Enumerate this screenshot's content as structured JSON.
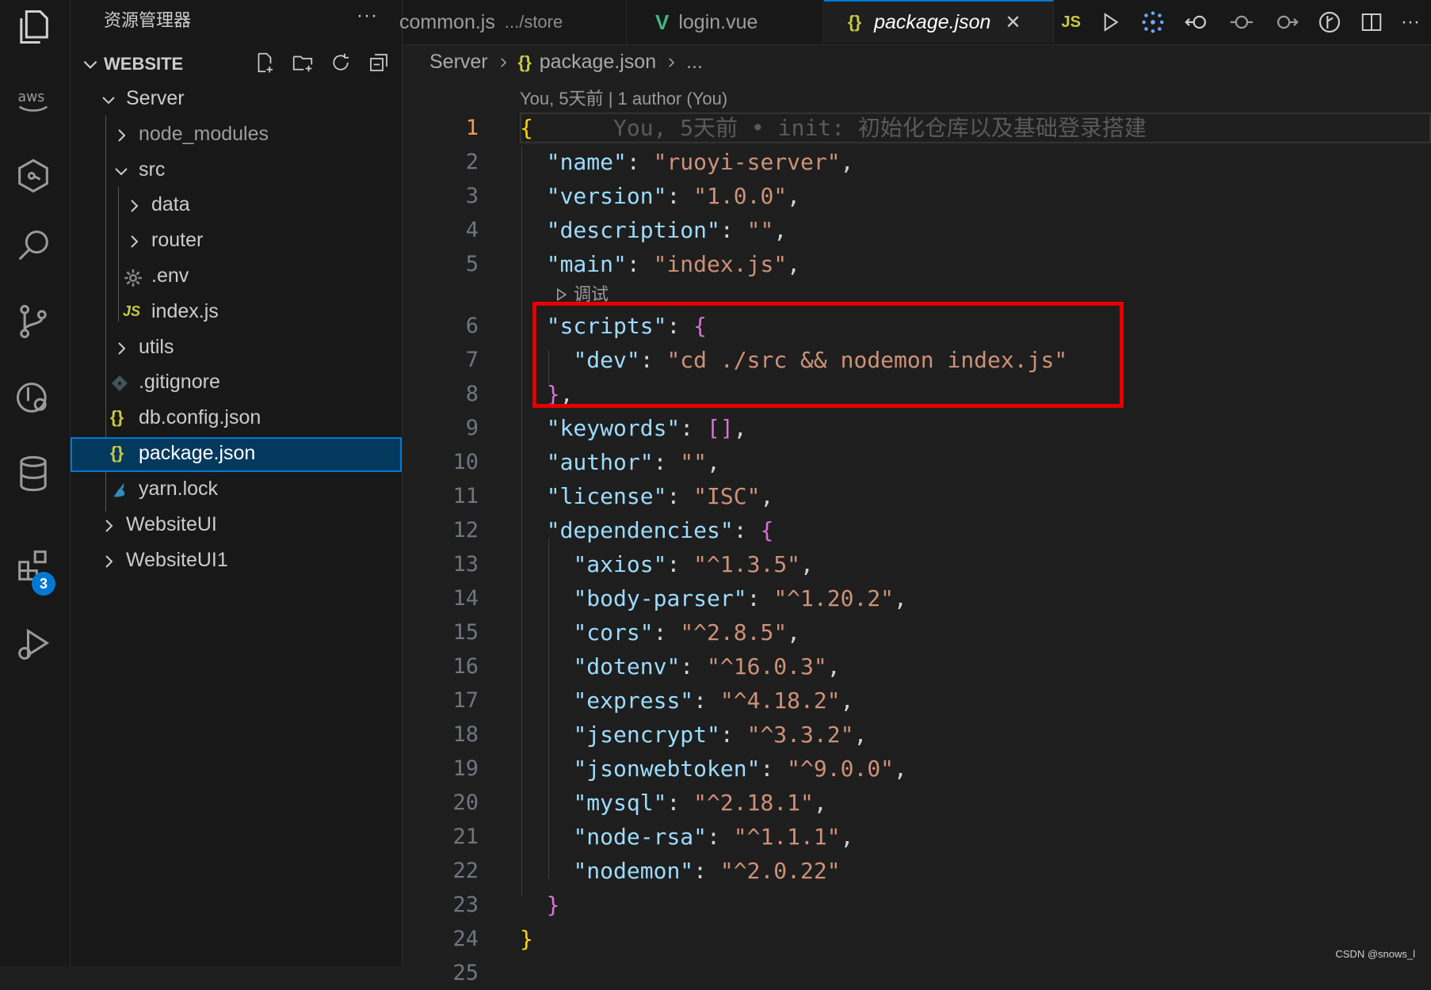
{
  "sidebar": {
    "title": "资源管理器",
    "more": "···",
    "workspace": "WEBSITE",
    "tree": [
      {
        "name": "Server"
      },
      {
        "name": "node_modules"
      },
      {
        "name": "src"
      },
      {
        "name": "data"
      },
      {
        "name": "router"
      },
      {
        "name": ".env"
      },
      {
        "name": "index.js",
        "icon": "JS"
      },
      {
        "name": "utils"
      },
      {
        "name": ".gitignore"
      },
      {
        "name": "db.config.json",
        "icon": "{}"
      },
      {
        "name": "package.json",
        "icon": "{}"
      },
      {
        "name": "yarn.lock"
      },
      {
        "name": "WebsiteUI"
      },
      {
        "name": "WebsiteUI1"
      }
    ]
  },
  "activity": {
    "extensions_badge": "3"
  },
  "tabs": [
    {
      "label": "common.js",
      "desc": ".../store"
    },
    {
      "label": "login.vue",
      "icon": "V"
    },
    {
      "label": "package.json",
      "icon": "{}",
      "close": "✕"
    }
  ],
  "tab_actions": {
    "js_label": "JS"
  },
  "breadcrumb": {
    "folder": "Server",
    "file": "package.json",
    "rest": "...",
    "icon": "{}"
  },
  "codelens": {
    "blame": "You, 5天前 | 1 author (You)",
    "debug": "调试"
  },
  "editor": {
    "lines": [
      "1",
      "2",
      "3",
      "4",
      "5",
      "6",
      "7",
      "8",
      "9",
      "10",
      "11",
      "12",
      "13",
      "14",
      "15",
      "16",
      "17",
      "18",
      "19",
      "20",
      "21",
      "22",
      "23",
      "24",
      "25"
    ],
    "inline_blame": "You, 5天前 • init: 初始化仓库以及基础登录搭建",
    "code": {
      "l1": "{",
      "name_k": "\"name\"",
      "name_v": "\"ruoyi-server\"",
      "version_k": "\"version\"",
      "version_v": "\"1.0.0\"",
      "description_k": "\"description\"",
      "description_v": "\"\"",
      "main_k": "\"main\"",
      "main_v": "\"index.js\"",
      "scripts_k": "\"scripts\"",
      "dev_k": "\"dev\"",
      "dev_v": "\"cd ./src && nodemon index.js\"",
      "keywords_k": "\"keywords\"",
      "keywords_v": "[]",
      "author_k": "\"author\"",
      "author_v": "\"\"",
      "license_k": "\"license\"",
      "license_v": "\"ISC\"",
      "deps_k": "\"dependencies\"",
      "deps": [
        {
          "k": "\"axios\"",
          "v": "\"^1.3.5\""
        },
        {
          "k": "\"body-parser\"",
          "v": "\"^1.20.2\""
        },
        {
          "k": "\"cors\"",
          "v": "\"^2.8.5\""
        },
        {
          "k": "\"dotenv\"",
          "v": "\"^16.0.3\""
        },
        {
          "k": "\"express\"",
          "v": "\"^4.18.2\""
        },
        {
          "k": "\"jsencrypt\"",
          "v": "\"^3.3.2\""
        },
        {
          "k": "\"jsonwebtoken\"",
          "v": "\"^9.0.0\""
        },
        {
          "k": "\"mysql\"",
          "v": "\"^2.18.1\""
        },
        {
          "k": "\"node-rsa\"",
          "v": "\"^1.1.1\""
        },
        {
          "k": "\"nodemon\"",
          "v": "\"^2.0.22\""
        }
      ]
    }
  },
  "watermark": "CSDN @snows_l",
  "colors": {
    "accent": "#0078d4",
    "highlight": "#e50000",
    "json_icon": "#cbcb41",
    "js_icon": "#cbcb41",
    "vue_icon": "#41b883"
  }
}
